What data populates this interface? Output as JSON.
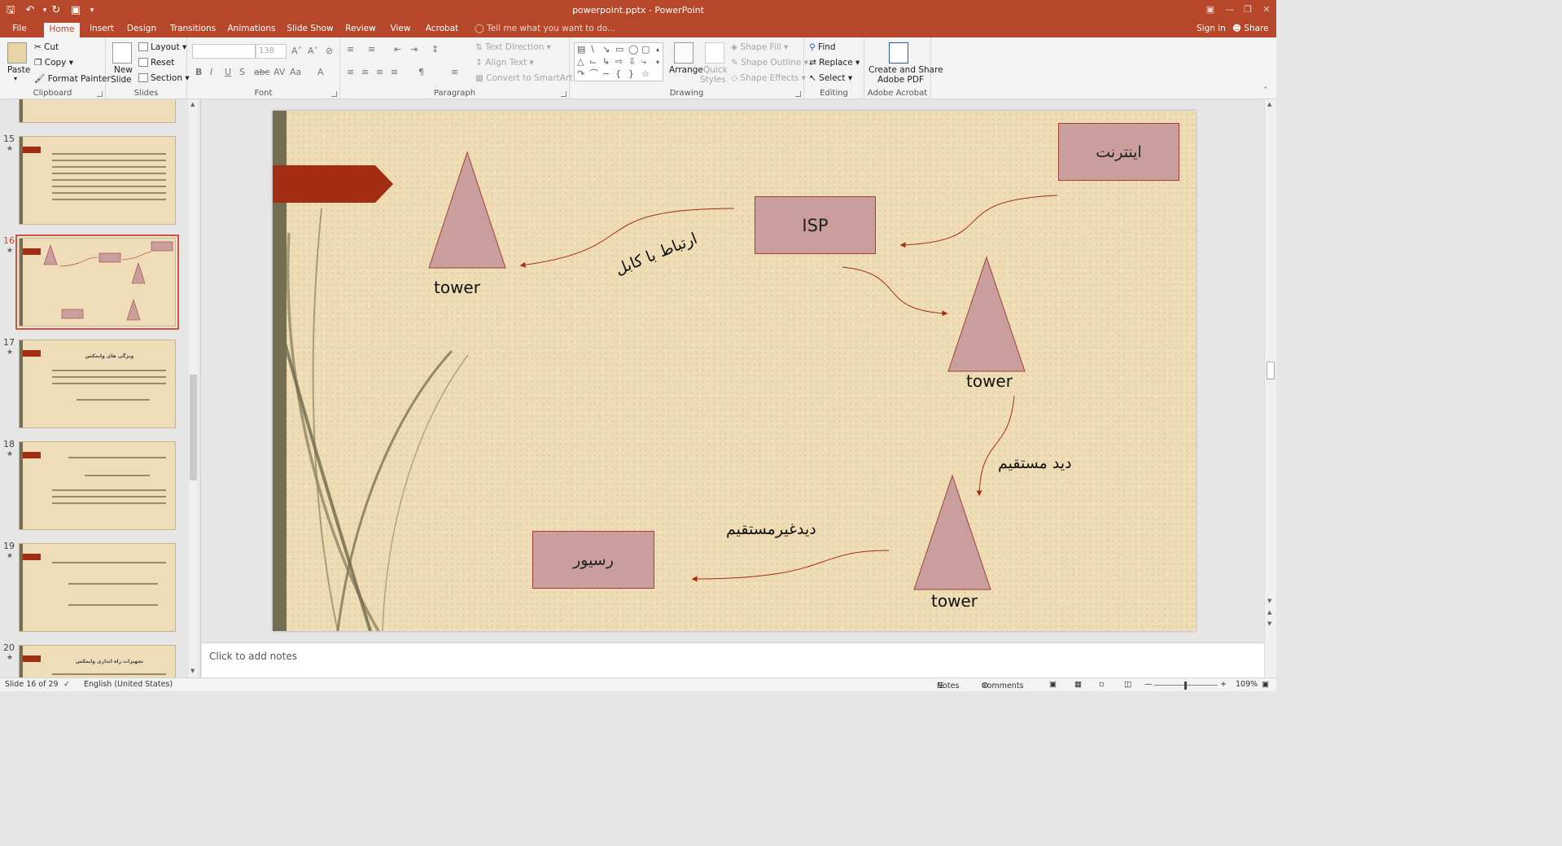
{
  "window": {
    "title": "powerpoint.pptx - PowerPoint"
  },
  "tabs": [
    "File",
    "Home",
    "Insert",
    "Design",
    "Transitions",
    "Animations",
    "Slide Show",
    "Review",
    "View",
    "Acrobat"
  ],
  "active_tab": "Home",
  "tell_me": "Tell me what you want to do...",
  "sign_in": "Sign in",
  "share": "Share",
  "ribbon": {
    "clipboard": {
      "label": "Clipboard",
      "paste": "Paste",
      "cut": "Cut",
      "copy": "Copy",
      "format_painter": "Format Painter"
    },
    "slides": {
      "label": "Slides",
      "new_slide_1": "New",
      "new_slide_2": "Slide",
      "layout": "Layout",
      "reset": "Reset",
      "section": "Section"
    },
    "font": {
      "label": "Font",
      "size": "138"
    },
    "paragraph": {
      "label": "Paragraph",
      "text_direction": "Text Direction",
      "align_text": "Align Text",
      "convert_smartart": "Convert to SmartArt"
    },
    "drawing": {
      "label": "Drawing",
      "arrange": "Arrange",
      "quick_styles_1": "Quick",
      "quick_styles_2": "Styles",
      "shape_fill": "Shape Fill",
      "shape_outline": "Shape Outline",
      "shape_effects": "Shape Effects"
    },
    "editing": {
      "label": "Editing",
      "find": "Find",
      "replace": "Replace",
      "select": "Select"
    },
    "acrobat": {
      "label": "Adobe Acrobat",
      "create_1": "Create and Share",
      "create_2": "Adobe PDF"
    }
  },
  "thumbnails": [
    {
      "num": "15"
    },
    {
      "num": "16"
    },
    {
      "num": "17",
      "title": "ویژگی های وایمکس"
    },
    {
      "num": "18"
    },
    {
      "num": "19"
    },
    {
      "num": "20",
      "title": "تجهیزات راه اندازی وایمکس"
    }
  ],
  "slide": {
    "internet": "اینترنت",
    "isp": "ISP",
    "receiver": "رسیور",
    "tower1": "tower",
    "tower2": "tower",
    "tower3": "tower",
    "cable": "ارتباط با کابل",
    "direct": "دید مستقیم",
    "indirect": "دیدغیرمستقیم"
  },
  "notes_placeholder": "Click to add notes",
  "status": {
    "slide_num": "Slide 16 of 29",
    "language": "English (United States)",
    "notes": "Notes",
    "comments": "Comments",
    "zoom": "109%"
  },
  "colors": {
    "accent": "#b7472a",
    "box_fill": "#c99e9c",
    "arrow": "#a32d12",
    "bar": "#746d52"
  }
}
